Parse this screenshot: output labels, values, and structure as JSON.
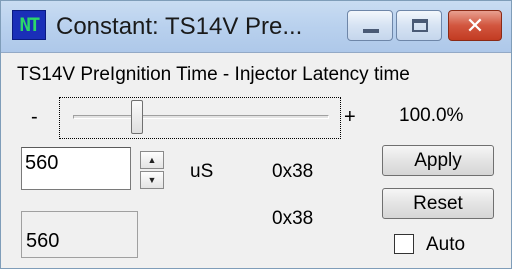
{
  "window": {
    "app_icon_text": "NT",
    "title": "Constant: TS14V Pre...",
    "controls": {
      "close_glyph": "✕"
    }
  },
  "description": "TS14V PreIgnition Time - Injector Latency time",
  "slider": {
    "min_label": "-",
    "max_label": "+",
    "percent_label": "100.0%",
    "level_fraction": 0.25
  },
  "value_input": {
    "value": "560"
  },
  "spinner": {
    "up_glyph": "▲",
    "down_glyph": "▼"
  },
  "unit": "uS",
  "hex_value": "0x38",
  "original": {
    "value": "560",
    "hex": "0x38"
  },
  "buttons": {
    "apply": "Apply",
    "reset": "Reset"
  },
  "auto_checkbox": {
    "label": "Auto",
    "checked": false
  },
  "colors": {
    "titlebar": "#b9d1ee",
    "close_button": "#c94a2f",
    "app_icon_bg": "#1a2fb8",
    "app_icon_text": "#2cd86a"
  }
}
